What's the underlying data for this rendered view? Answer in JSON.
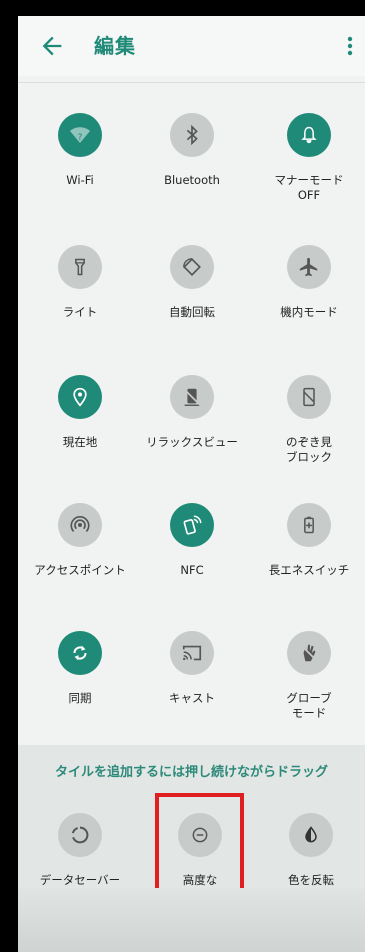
{
  "header": {
    "back_icon": "arrow-left-icon",
    "title": "編集",
    "menu_icon": "more-vert-icon"
  },
  "active_tiles": [
    {
      "id": "wifi",
      "icon": "wifi-icon",
      "label": "Wi-Fi",
      "state": "on"
    },
    {
      "id": "bluetooth",
      "icon": "bluetooth-icon",
      "label": "Bluetooth",
      "state": "off"
    },
    {
      "id": "manner",
      "icon": "bell-icon",
      "label": "マナーモード\nOFF",
      "state": "on"
    },
    {
      "id": "light",
      "icon": "flashlight-icon",
      "label": "ライト",
      "state": "off"
    },
    {
      "id": "rotate",
      "icon": "rotate-icon",
      "label": "自動回転",
      "state": "off"
    },
    {
      "id": "airplane",
      "icon": "airplane-icon",
      "label": "機内モード",
      "state": "off"
    },
    {
      "id": "location",
      "icon": "location-pin-icon",
      "label": "現在地",
      "state": "on"
    },
    {
      "id": "relax",
      "icon": "relax-view-icon",
      "label": "リラックスビュー",
      "state": "off"
    },
    {
      "id": "peek",
      "icon": "peek-block-icon",
      "label": "のぞき見\nブロック",
      "state": "off"
    },
    {
      "id": "hotspot",
      "icon": "hotspot-icon",
      "label": "アクセスポイント",
      "state": "off"
    },
    {
      "id": "nfc",
      "icon": "nfc-icon",
      "label": "NFC",
      "state": "on"
    },
    {
      "id": "battery",
      "icon": "battery-saver-icon",
      "label": "長エネスイッチ",
      "state": "off"
    },
    {
      "id": "sync",
      "icon": "sync-icon",
      "label": "同期",
      "state": "on"
    },
    {
      "id": "cast",
      "icon": "cast-icon",
      "label": "キャスト",
      "state": "off"
    },
    {
      "id": "glove",
      "icon": "glove-icon",
      "label": "グローブ\nモード",
      "state": "off"
    }
  ],
  "drag_section": {
    "hint": "タイルを追加するには押し続けながらドラッグ",
    "tiles": [
      {
        "id": "datasaver",
        "icon": "data-saver-icon",
        "label": "データセーバー"
      },
      {
        "id": "advanced_manner",
        "icon": "minus-circle-icon",
        "label": "高度な\nマナーモード"
      },
      {
        "id": "invert",
        "icon": "invert-colors-icon",
        "label": "色を反転"
      }
    ]
  },
  "colors": {
    "accent": "#1f8a78",
    "tile_off": "#c7cbc9",
    "highlight": "#e02020"
  }
}
